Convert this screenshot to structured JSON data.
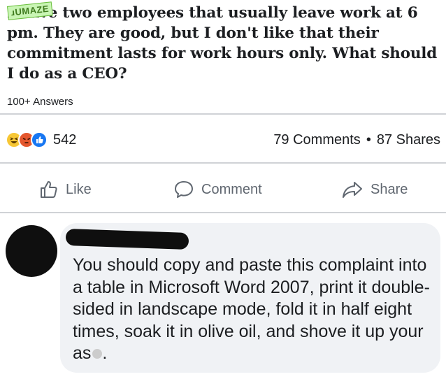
{
  "post": {
    "watermark": "ɹUMAZE",
    "question": "I have two employees that usually leave work at 6 pm. They are good, but I don't like that their commitment lasts for work hours only. What should I do as a CEO?",
    "answers_count": "100+ Answers"
  },
  "engagement": {
    "reaction_icons": [
      "haha-icon",
      "angry-icon",
      "like-icon"
    ],
    "reaction_count": "542",
    "comments": "79 Comments",
    "separator": "•",
    "shares": "87 Shares"
  },
  "actions": {
    "like_label": "Like",
    "comment_label": "Comment",
    "share_label": "Share"
  },
  "comment": {
    "text": "You should copy and paste this complaint into a table in Microsoft Word 2007, print it double-sided in landscape mode, fold it in half eight times, soak it in olive oil, and shove it up your as"
  },
  "colors": {
    "text": "#1c1e21",
    "muted": "#606770",
    "bubble": "#f0f2f5",
    "divider": "#d0d2d6",
    "facebook_blue": "#1877f2"
  }
}
